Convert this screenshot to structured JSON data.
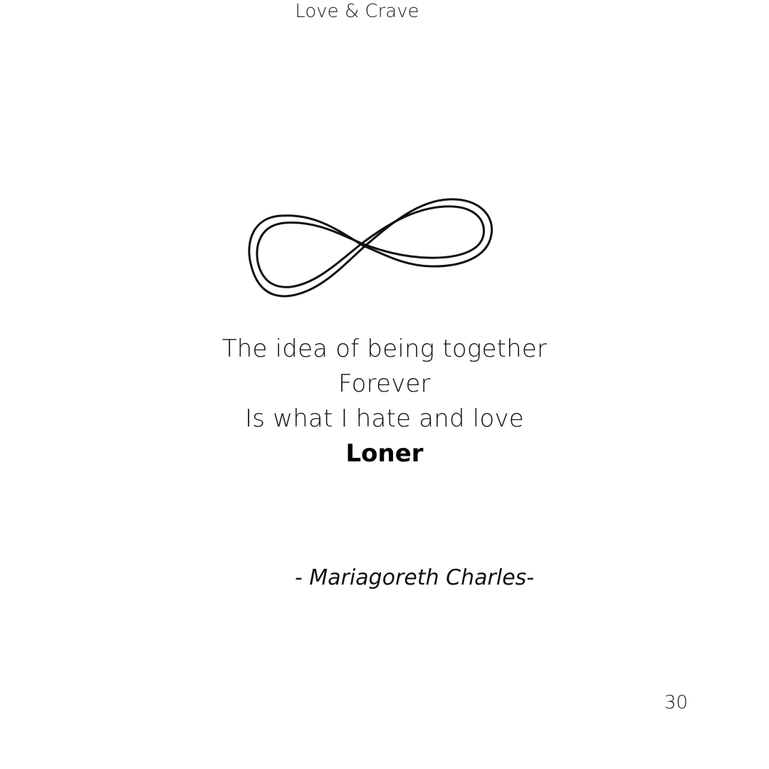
{
  "header": {
    "title": "Love & Crave"
  },
  "illustration": {
    "icon": "infinity-icon",
    "stroke_color": "#111111"
  },
  "poem": {
    "lines": [
      "The idea of being together",
      "Forever",
      "Is what I hate and love"
    ],
    "title": "Loner"
  },
  "signature": {
    "text": "- Mariagoreth Charles-"
  },
  "footer": {
    "page_number": "30"
  }
}
